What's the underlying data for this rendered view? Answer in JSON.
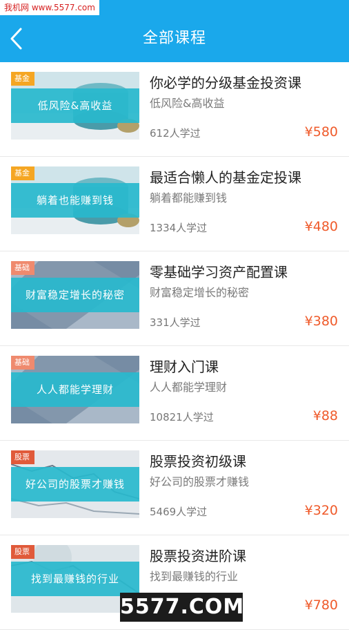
{
  "watermark": {
    "top": "我机网 www.5577.com",
    "bottom": "5577.COM"
  },
  "header": {
    "title": "全部课程",
    "back_icon": "chevron-left-icon",
    "bg": "#1aa8eb"
  },
  "colors": {
    "price": "#ef5a2a",
    "tag_fund": "#f5a623",
    "tag_basic": "#ef8a6e",
    "tag_stock": "#e05a3a"
  },
  "courses": [
    {
      "tag": "基金",
      "thumb_text": "低风险&高收益",
      "name": "你必学的分级基金投资课",
      "subtitle": "低风险&高收益",
      "learners": "612人学过",
      "price": "¥580"
    },
    {
      "tag": "基金",
      "thumb_text": "躺着也能赚到钱",
      "name": "最适合懒人的基金定投课",
      "subtitle": "躺着都能赚到钱",
      "learners": "1334人学过",
      "price": "¥480"
    },
    {
      "tag": "基础",
      "thumb_text": "财富稳定增长的秘密",
      "name": "零基础学习资产配置课",
      "subtitle": "财富稳定增长的秘密",
      "learners": "331人学过",
      "price": "¥380"
    },
    {
      "tag": "基础",
      "thumb_text": "人人都能学理财",
      "name": "理财入门课",
      "subtitle": "人人都能学理财",
      "learners": "10821人学过",
      "price": "¥88"
    },
    {
      "tag": "股票",
      "thumb_text": "好公司的股票才赚钱",
      "name": "股票投资初级课",
      "subtitle": "好公司的股票才赚钱",
      "learners": "5469人学过",
      "price": "¥320"
    },
    {
      "tag": "股票",
      "thumb_text": "找到最赚钱的行业",
      "name": "股票投资进阶课",
      "subtitle": "找到最赚钱的行业",
      "learners": "",
      "price": "¥780"
    }
  ]
}
